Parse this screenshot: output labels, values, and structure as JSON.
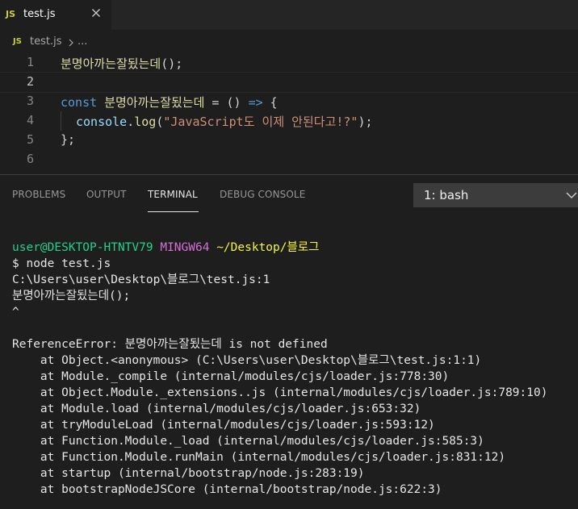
{
  "tab": {
    "icon_text": "JS",
    "label": "test.js",
    "close_icon": "close-icon"
  },
  "breadcrumb": {
    "icon_text": "JS",
    "file": "test.js",
    "more": "..."
  },
  "editor": {
    "lines": [
      {
        "number": "1",
        "text": "분명아까는잘됬는데();"
      },
      {
        "number": "2",
        "text": ""
      },
      {
        "number": "3",
        "text": "const 분명아까는잘됬는데 = () => {"
      },
      {
        "number": "4",
        "text": "  console.log(\"JavaScript도 이제 안된다고!?\");"
      },
      {
        "number": "5",
        "text": "};"
      },
      {
        "number": "6",
        "text": ""
      }
    ],
    "tokens": {
      "l1_fn": "분명아까는잘됬는데",
      "l1_rest": "();",
      "l3_const": "const",
      "l3_fn": "분명아까는잘됬는데",
      "l3_eq": " = ",
      "l3_parens": "()",
      "l3_arrow": "=>",
      "l3_brace": " {",
      "l4_console": "console",
      "l4_dot": ".",
      "l4_log": "log",
      "l4_open": "(",
      "l4_str": "\"JavaScript도 이제 안된다고!?\"",
      "l4_close": ");",
      "l5": "};"
    }
  },
  "panel": {
    "tabs": [
      "PROBLEMS",
      "OUTPUT",
      "TERMINAL",
      "DEBUG CONSOLE"
    ],
    "active_tab": "TERMINAL",
    "terminal_select": "1: bash"
  },
  "terminal": {
    "prompt_user": "user@DESKTOP-HTNTV79",
    "prompt_env": "MINGW64",
    "prompt_path": "~/Desktop/블로그",
    "command": "$ node test.js",
    "output": [
      "C:\\Users\\user\\Desktop\\블로그\\test.js:1",
      "분명아까는잘됬는데();",
      "^",
      "",
      "ReferenceError: 분명아까는잘됬는데 is not defined",
      "    at Object.<anonymous> (C:\\Users\\user\\Desktop\\블로그\\test.js:1:1)",
      "    at Module._compile (internal/modules/cjs/loader.js:778:30)",
      "    at Object.Module._extensions..js (internal/modules/cjs/loader.js:789:10)",
      "    at Module.load (internal/modules/cjs/loader.js:653:32)",
      "    at tryModuleLoad (internal/modules/cjs/loader.js:593:12)",
      "    at Function.Module._load (internal/modules/cjs/loader.js:585:3)",
      "    at Function.Module.runMain (internal/modules/cjs/loader.js:831:12)",
      "    at startup (internal/bootstrap/node.js:283:19)",
      "    at bootstrapNodeJSCore (internal/bootstrap/node.js:622:3)"
    ]
  },
  "colors": {
    "editor_bg": "#1e1e1e",
    "tabstrip_bg": "#252526",
    "js_icon": "#cbcb41",
    "function_name": "#dcdcaa",
    "keyword": "#569cd6",
    "variable": "#9cdcfe",
    "string": "#ce9178",
    "terminal_green": "#23d18b",
    "terminal_magenta": "#d670d6",
    "terminal_yellow": "#f5f543"
  }
}
